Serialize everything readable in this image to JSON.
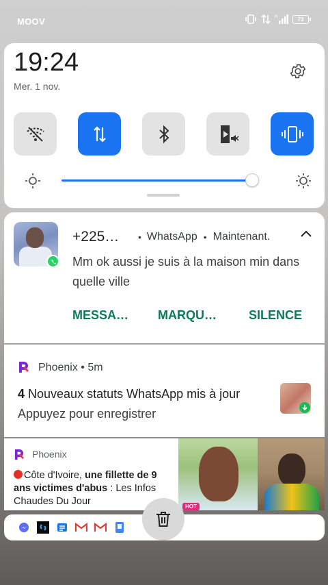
{
  "statusbar": {
    "carrier": "MOOV",
    "battery": "73"
  },
  "quick_settings": {
    "time": "19:24",
    "date": "Mer. 1 nov.",
    "tiles": [
      {
        "name": "wifi",
        "icon": "wifi-off-icon",
        "active": false
      },
      {
        "name": "mobile-data",
        "icon": "data-arrows-icon",
        "active": true
      },
      {
        "name": "bluetooth",
        "icon": "bluetooth-icon",
        "active": false
      },
      {
        "name": "cast",
        "icon": "cast-mute-icon",
        "active": false
      },
      {
        "name": "vibrate",
        "icon": "vibrate-icon",
        "active": true
      }
    ],
    "brightness_fraction": 0.93,
    "accent_color": "#1a73f0"
  },
  "notif_whatsapp": {
    "sender": "+225…",
    "app": "WhatsApp",
    "time": "Maintenant.",
    "body": "Mm ok aussi je suis à la maison min dans quelle ville",
    "actions": [
      "MESSA…",
      "MARQU…",
      "SILENCE"
    ],
    "action_color": "#0b7a5c"
  },
  "notif_phoenix": {
    "app": "Phoenix",
    "time": "5m",
    "title_count": "4",
    "title_rest": " Nouveaux statuts WhatsApp mis à jour",
    "subtitle": "Appuyez pour enregistrer"
  },
  "notif_news": {
    "app": "Phoenix",
    "text_prefix": "Côte d'Ivoire, ",
    "text_bold": "une fillette de 9 ans victimes d'abus",
    "text_suffix": " : Les Infos Chaudes Du Jour",
    "badge": "HOT"
  },
  "dock": {
    "icons": [
      "messenger-icon",
      "shazam-icon",
      "news-icon",
      "gmail-icon",
      "gmail-icon",
      "phone-icon"
    ]
  }
}
